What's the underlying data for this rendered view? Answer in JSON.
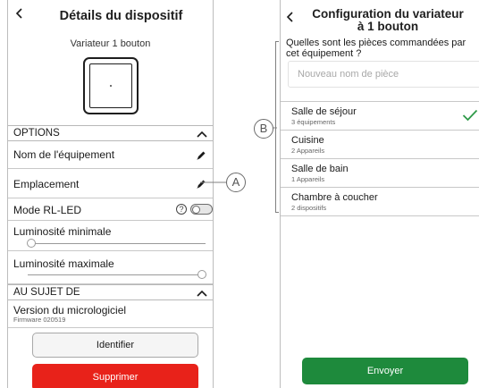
{
  "left": {
    "header": {
      "title": "Détails du dispositif"
    },
    "device": {
      "name": "Variateur 1 bouton"
    },
    "options": {
      "section_label": "OPTIONS",
      "rows": [
        {
          "label": "Nom de l'équipement"
        },
        {
          "label": "Emplacement"
        },
        {
          "label": "Mode RL-LED",
          "toggle_on": false
        }
      ]
    },
    "brightness": {
      "min_label": "Luminosité minimale",
      "min_value": 0.02,
      "max_label": "Luminosité maximale",
      "max_value": 0.98
    },
    "about": {
      "section_label": "AU SUJET DE",
      "firmware_title": "Version du micrologiciel",
      "firmware_value": "Firmware 020519"
    },
    "buttons": {
      "identify": "Identifier",
      "delete": "Supprimer"
    },
    "colors": {
      "delete": "#e8221a"
    }
  },
  "callouts": {
    "a": "A",
    "b": "B"
  },
  "right": {
    "header": {
      "title_line1": "Configuration du variateur",
      "title_line2": "à 1 bouton"
    },
    "question": "Quelles sont les pièces commandées par cet équipement ?",
    "new_room": {
      "placeholder": "Nouveau nom de pièce"
    },
    "rooms": [
      {
        "name": "Salle de séjour",
        "count": "3 équipements",
        "selected": true
      },
      {
        "name": "Cuisine",
        "count": "2 Appareils",
        "selected": false
      },
      {
        "name": "Salle de bain",
        "count": "1 Appareils",
        "selected": false
      },
      {
        "name": "Chambre à coucher",
        "count": "2 dispositifs",
        "selected": false
      }
    ],
    "buttons": {
      "send": "Envoyer"
    },
    "colors": {
      "send": "#1e8a3c",
      "check": "#2e9a48"
    }
  }
}
